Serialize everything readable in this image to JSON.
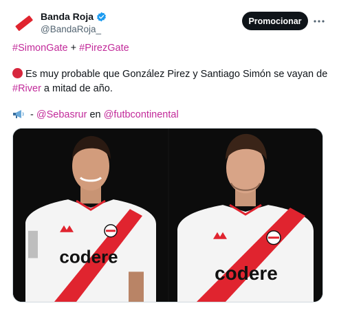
{
  "account": {
    "display_name": "Banda Roja",
    "handle": "@BandaRoja_",
    "verified": true,
    "avatar_icon": "red-bar-logo-icon"
  },
  "actions": {
    "promote_label": "Promocionar",
    "more_icon": "more-horizontal-icon"
  },
  "post": {
    "hashtag_1": "#SimonGate",
    "plus": " + ",
    "hashtag_2": "#PirezGate",
    "line2_text": "Es muy probable que González Pirez y Santiago Simón se vayan de",
    "hashtag_river": "#River",
    "line3_text": " a mitad de año.",
    "dash_text": " - ",
    "mention_1": "@Sebasrur",
    "en_text": " en ",
    "mention_2": "@futbcontinental"
  },
  "media": {
    "left_sponsor": "codere",
    "right_sponsor": "codere"
  },
  "colors": {
    "link": "#c22a9a",
    "brand_red": "#e0242f",
    "text": "#0f1419",
    "secondary": "#536471"
  }
}
